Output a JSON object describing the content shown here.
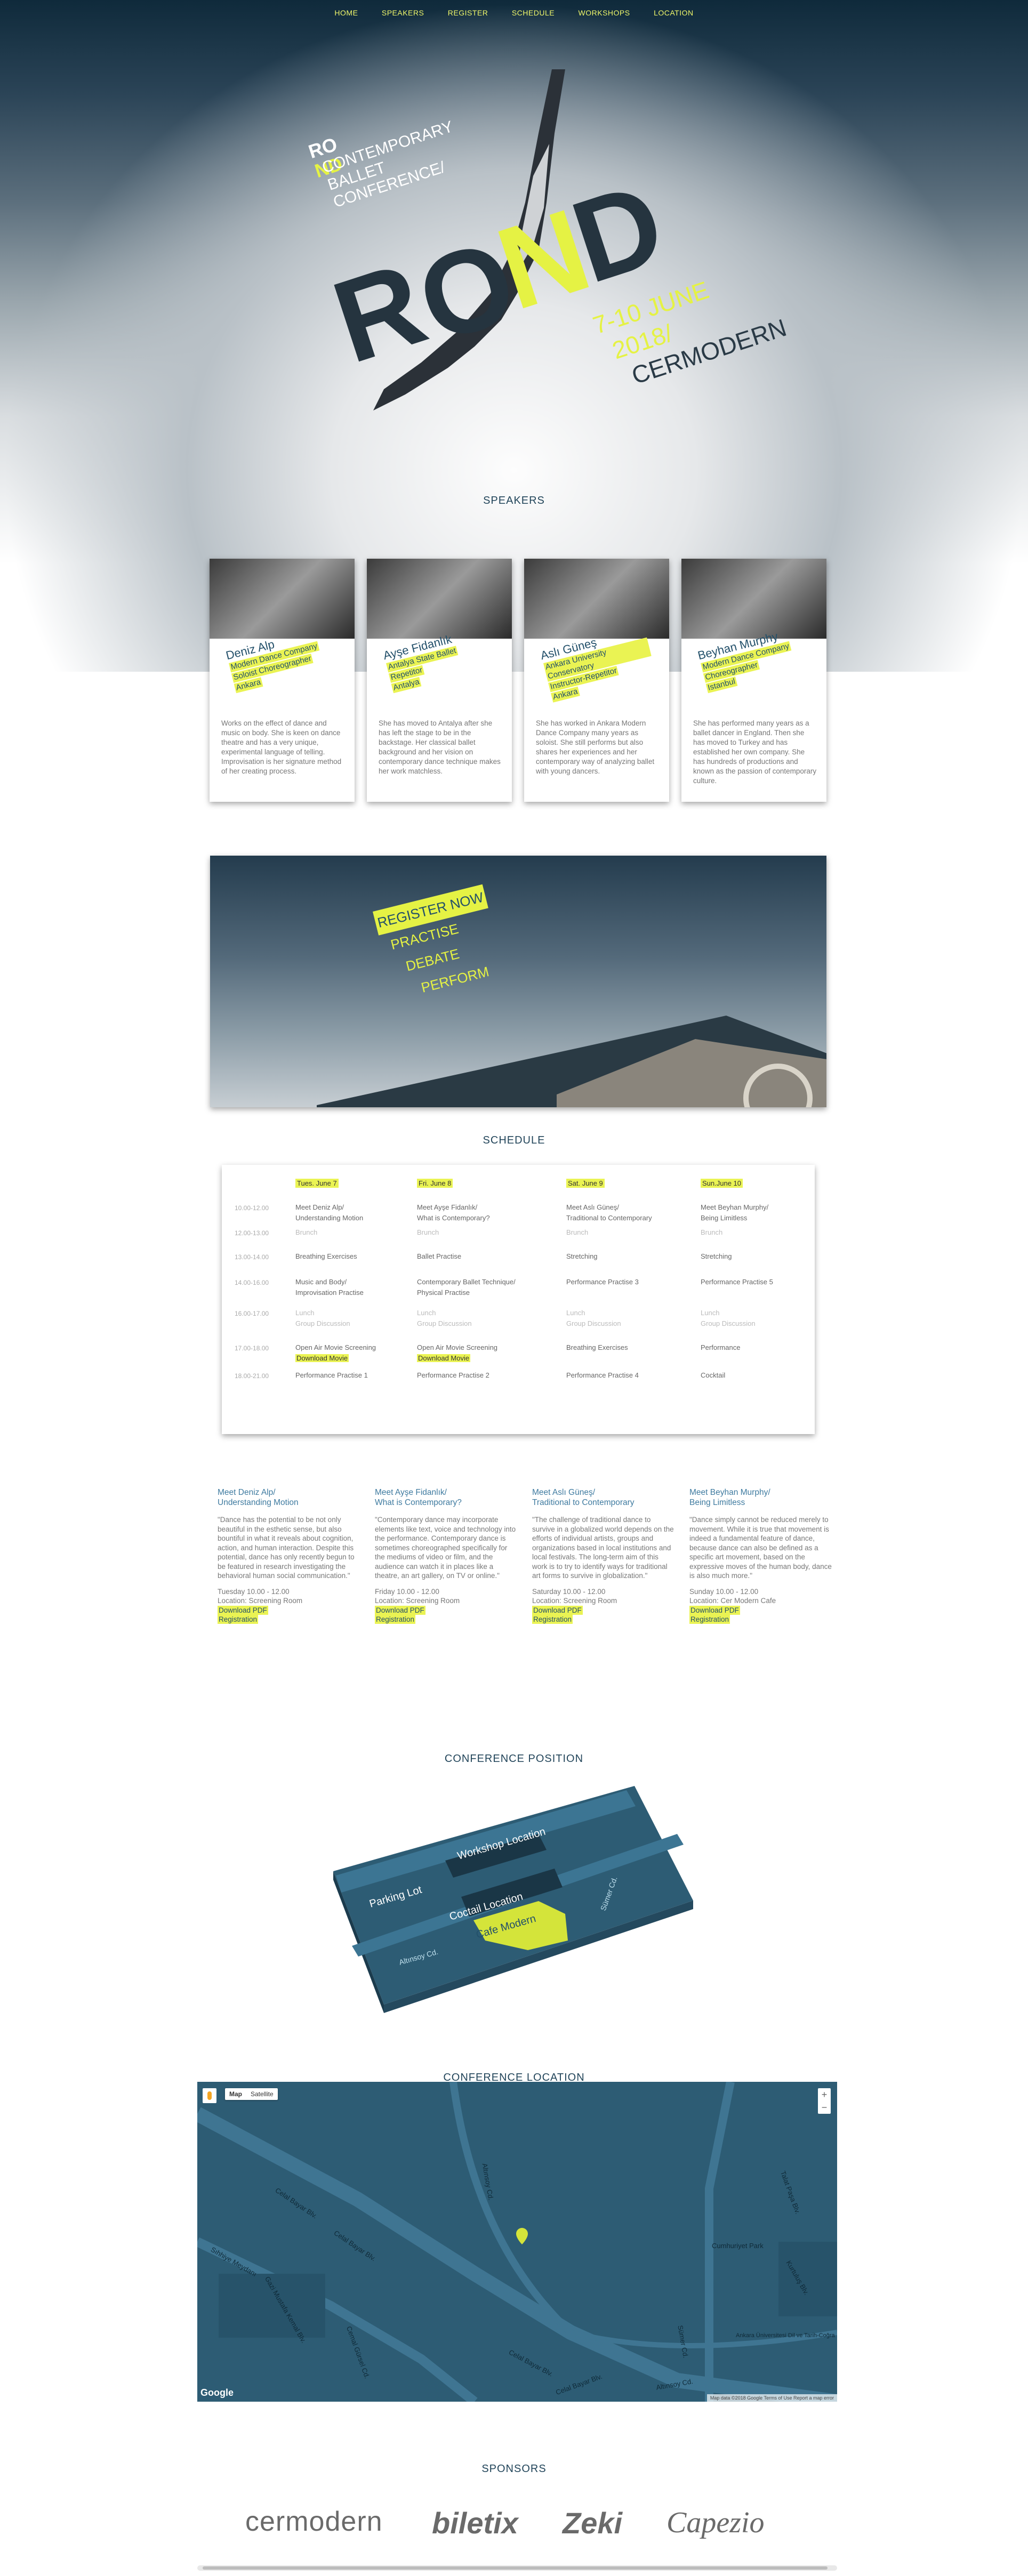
{
  "nav": {
    "items": [
      "HOME",
      "SPEAKERS",
      "REGISTER",
      "SCHEDULE",
      "WORKSHOPS",
      "LOCATION"
    ]
  },
  "hero": {
    "logo_ro": "RO",
    "logo_nd": "ND",
    "sub1": "CONTEMPORARY",
    "sub2": "BALLET",
    "sub3": "CONFERENCE/",
    "big_r": "R",
    "big_o": "O",
    "big_n": "N",
    "big_d": "D",
    "date1": "7-10 JUNE",
    "date2": "2018/",
    "date3": "CERMODERN"
  },
  "sections": {
    "speakers": "SPEAKERS",
    "schedule": "SCHEDULE",
    "position": "CONFERENCE POSITION",
    "location": "CONFERENCE LOCATION",
    "sponsors": "SPONSORS"
  },
  "speakers": [
    {
      "name": "Deniz Alp",
      "roles": [
        "Modern Dance Company",
        "Soloist Choreographer",
        "Ankara"
      ],
      "desc": "Works on the effect of dance and music on body. She is keen on dance theatre and has a very unique, experimental language of telling. Improvisation is her signature method of her creating process."
    },
    {
      "name": "Ayşe Fidanlık",
      "roles": [
        "Antalya State Ballet",
        "Repetitor",
        "Antalya"
      ],
      "desc": "She has moved to Antalya after she has left the stage to be in the backstage. Her classical ballet background and her vision on contemporary dance technique makes her work matchless."
    },
    {
      "name": "Aslı Güneş",
      "roles": [
        "Ankara University Conservatory",
        "Instructor-Repetitor",
        "Ankara"
      ],
      "desc": "She has worked in Ankara Modern Dance Company many years as soloist. She still performs but also shares her experiences and her contemporary way of analyzing ballet with young dancers."
    },
    {
      "name": "Beyhan Murphy",
      "roles": [
        "Modern Dance Company",
        "Choreographer",
        "Istanbul"
      ],
      "desc": "She has performed many years as a ballet dancer in England. Then she has moved to Turkey and has established her own company. She has hundreds of productions and known as the passion of contemporary culture."
    }
  ],
  "register": {
    "now": "REGISTER NOW",
    "l1": "PRACTISE",
    "l2": "DEBATE",
    "l3": "PERFORM"
  },
  "schedule": {
    "days": [
      "Tues. June 7",
      "Fri. June 8",
      "Sat. June 9",
      "Sun.June 10"
    ],
    "rows": [
      {
        "time": "10.00-12.00",
        "cells": [
          "Meet Deniz Alp/\nUnderstanding Motion",
          "Meet Ayşe Fidanlık/\nWhat is Contemporary?",
          "Meet Aslı Güneş/\nTraditional to Contemporary",
          "Meet Beyhan Murphy/\nBeing Limitless"
        ]
      },
      {
        "time": "12.00-13.00",
        "cells": [
          "Brunch",
          "Brunch",
          "Brunch",
          "Brunch"
        ]
      },
      {
        "time": "13.00-14.00",
        "cells": [
          "Breathing Exercises",
          "Ballet Practise",
          "Stretching",
          "Stretching"
        ]
      },
      {
        "time": "14.00-16.00",
        "cells": [
          "Music and Body/\nImprovisation Practise",
          "Contemporary Ballet Technique/\nPhysical Practise",
          "Performance Practise 3",
          "Performance Practise 5"
        ]
      },
      {
        "time": "16.00-17.00",
        "cells": [
          "Lunch\nGroup Discussion",
          "Lunch\nGroup Discussion",
          "Lunch\nGroup Discussion",
          "Lunch\nGroup Discussion"
        ]
      },
      {
        "time": "17.00-18.00",
        "cells": [
          "Open Air Movie Screening",
          "Open Air Movie Screening",
          "Breathing Exercises",
          "Performance"
        ]
      },
      {
        "time": "18.00-21.00",
        "cells": [
          "Performance Practise 1",
          "Performance Practise 2",
          "Performance Practise 4",
          "Cocktail"
        ]
      }
    ],
    "download_movie": "Download Movie"
  },
  "talks": [
    {
      "title": "Meet Deniz Alp/\nUnderstanding Motion",
      "quote": "\"Dance has the potential to be not only beautiful in the esthetic sense, but also bountiful in what it reveals about cognition, action, and human interaction. Despite this potential, dance has only recently begun to be featured in research investigating the behavioral human social communication.\"",
      "when": "Tuesday 10.00 - 12.00",
      "where": "Location: Screening Room"
    },
    {
      "title": "Meet Ayşe Fidanlık/\nWhat is Contemporary?",
      "quote": "\"Contemporary dance may incorporate elements like text, voice and technology into the performance. Contemporary dance is sometimes choreographed specifically for the mediums of video or film, and the audience can watch it in places like a theatre, an art gallery, on TV or online.\"",
      "when": "Friday 10.00 - 12.00",
      "where": "Location: Screening Room"
    },
    {
      "title": "Meet Aslı Güneş/\nTraditional to Contemporary",
      "quote": "\"The challenge of traditional dance to survive in a globalized world depends on the efforts of individual artists, groups and organizations based in local institutions and local festivals. The long-term aim of this work is to try to identify ways for traditional art forms to survive in globalization.\"",
      "when": "Saturday 10.00 - 12.00",
      "where": "Location: Screening Room"
    },
    {
      "title": "Meet Beyhan Murphy/\nBeing Limitless",
      "quote": "\"Dance simply cannot be reduced merely to movement. While it is true that movement is indeed a fundamental feature of dance, because dance can also be defined as a specific art movement, based on the expressive moves of the human body, dance is also much more.\"",
      "when": "Sunday 10.00 - 12.00",
      "where": "Location: Cer Modern Cafe"
    }
  ],
  "talk_links": {
    "pdf": "Download PDF",
    "reg": "Registration"
  },
  "position_map": {
    "workshop": "Workshop Location",
    "parking": "Parking Lot",
    "cocktail": "Coctail Location",
    "cafe": "Cafe Modern",
    "street1": "Altınsoy Cd.",
    "street2": "Sümer Cd."
  },
  "map": {
    "type_map": "Map",
    "type_sat": "Satellite",
    "zoom_in": "+",
    "zoom_out": "−",
    "google": "Google",
    "footer": "Map data ©2018 Google   Terms of Use   Report a map error",
    "streets": [
      "Celal Bayar Blv.",
      "Celal Bayar Blv.",
      "Celal Bayar Blv.",
      "Celal Bayar Blv.",
      "Altınsoy Cd.",
      "Altınsoy Cd.",
      "Cumhuriyet Park",
      "Ankara Üniversitesi Dil ve Tarih-Coğra",
      "Talat Paşa Blv.",
      "Sümer Cd.",
      "Gazi Mustafa Kemal Blv.",
      "Cemal Gürsel Cd.",
      "Kurtuluş Blv.",
      "Sıhhiye Meydanı"
    ]
  },
  "sponsors": [
    "cermodern",
    "biletix",
    "Zeki",
    "Capezio"
  ]
}
